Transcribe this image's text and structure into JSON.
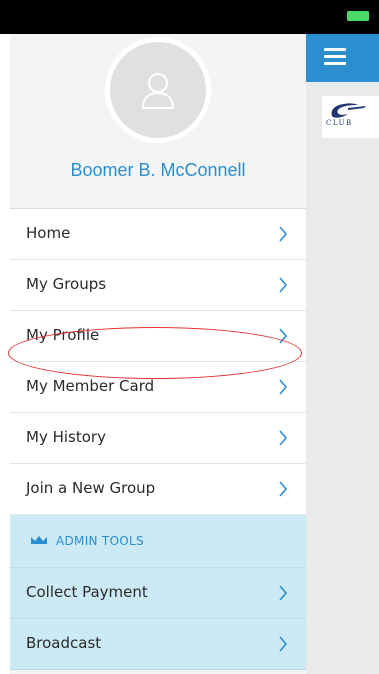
{
  "user": {
    "name": "Boomer B. McConnell"
  },
  "menu": {
    "items": [
      {
        "label": "Home"
      },
      {
        "label": "My Groups"
      },
      {
        "label": "My Profile"
      },
      {
        "label": "My Member Card"
      },
      {
        "label": "My History"
      },
      {
        "label": "Join a New Group"
      }
    ]
  },
  "admin": {
    "title": "ADMIN TOOLS",
    "items": [
      {
        "label": "Collect Payment"
      },
      {
        "label": "Broadcast"
      }
    ]
  },
  "logo": {
    "text": "CLUB"
  },
  "colors": {
    "accent": "#2b8ece",
    "admin_bg": "#cbeaf5",
    "highlight": "#e53030",
    "battery": "#4cd964"
  },
  "icons": {
    "menu": "hamburger-menu-icon",
    "chevron": "chevron-right-icon",
    "admin": "crown-icon",
    "avatar": "user-silhouette-icon"
  }
}
